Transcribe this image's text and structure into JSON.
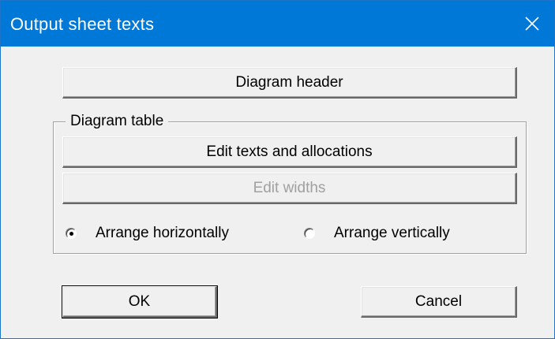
{
  "dialog": {
    "title": "Output sheet texts",
    "close_icon": "close-icon"
  },
  "buttons": {
    "diagram_header": "Diagram header",
    "edit_texts": "Edit texts and allocations",
    "edit_widths": "Edit widths",
    "ok": "OK",
    "cancel": "Cancel"
  },
  "diagram_table": {
    "label": "Diagram table",
    "arrange": {
      "selected": "horizontal",
      "horizontal_label": "Arrange horizontally",
      "vertical_label": "Arrange vertically"
    },
    "edit_widths_enabled": false
  },
  "colors": {
    "titlebar": "#0078d7",
    "client_bg": "#f0f0f0",
    "disabled_text": "#a0a0a0"
  }
}
